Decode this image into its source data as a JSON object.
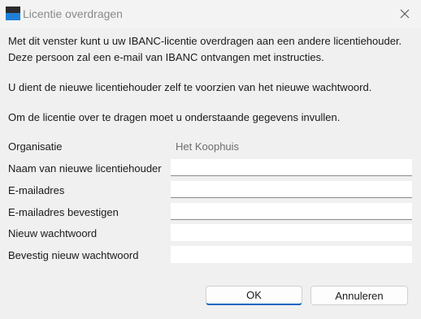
{
  "window": {
    "title": "Licentie overdragen",
    "icon": "ibanc-app-icon",
    "close_icon": "close-icon"
  },
  "intro": {
    "line1": "Met dit venster kunt u uw IBANC-licentie overdragen aan een andere licentiehouder.",
    "line2": "Deze persoon zal een e-mail van IBANC ontvangen met instructies.",
    "line3": "U dient de nieuwe licentiehouder zelf te voorzien van het nieuwe wachtwoord.",
    "line4": "Om de licentie over te dragen moet u onderstaande gegevens invullen."
  },
  "form": {
    "organisation": {
      "label": "Organisatie",
      "value": "Het Koophuis"
    },
    "new_holder": {
      "label": "Naam van nieuwe licentiehouder",
      "value": ""
    },
    "email": {
      "label": "E-mailadres",
      "value": ""
    },
    "email_confirm": {
      "label": "E-mailadres bevestigen",
      "value": ""
    },
    "password": {
      "label": "Nieuw wachtwoord",
      "value": ""
    },
    "password_confirm": {
      "label": "Bevestig nieuw wachtwoord",
      "value": ""
    }
  },
  "buttons": {
    "ok": "OK",
    "cancel": "Annuleren"
  },
  "colors": {
    "accent": "#0067c0",
    "icon_blue": "#1f7fd6",
    "icon_dark": "#2b2b2b"
  }
}
